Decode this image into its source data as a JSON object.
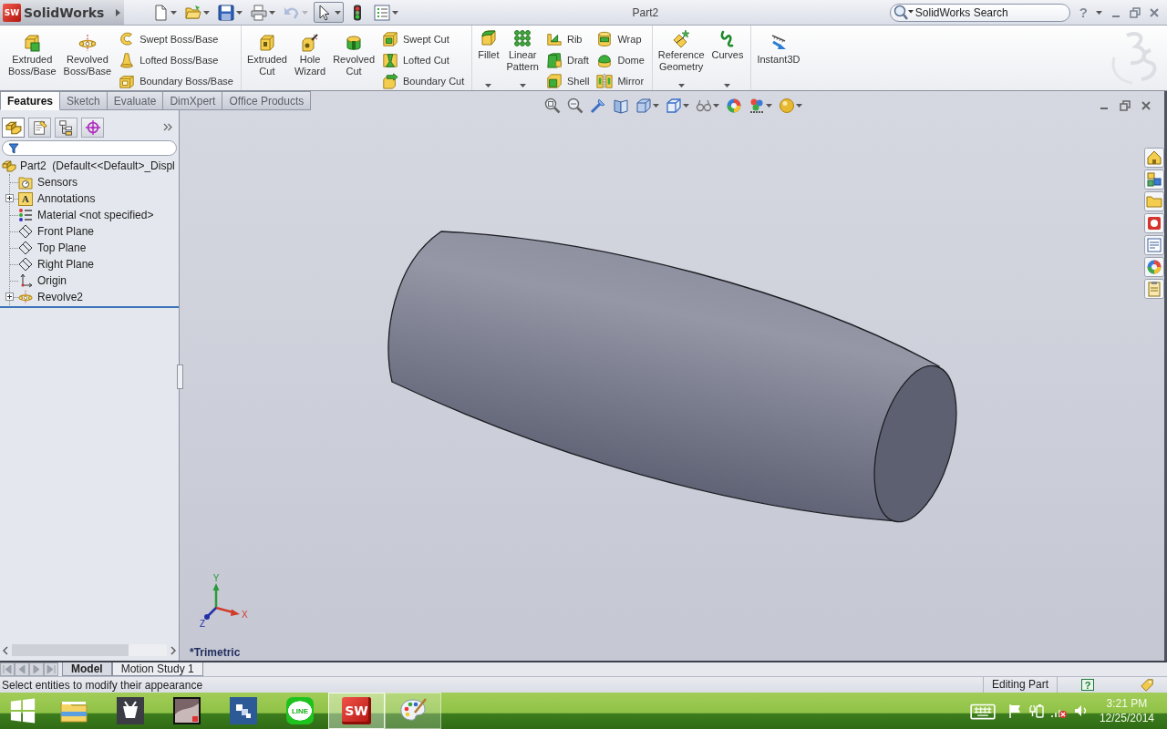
{
  "app": {
    "logo_mark": "SW",
    "name": "SolidWorks",
    "title": "Part2",
    "search": {
      "placeholder": "SolidWorks Search"
    },
    "help": "?"
  },
  "quick_access": [
    {
      "kind": "new",
      "dropdown": true,
      "disabled": false,
      "selected": false
    },
    {
      "kind": "open",
      "dropdown": true,
      "disabled": false,
      "selected": false
    },
    {
      "kind": "save",
      "dropdown": true,
      "disabled": false,
      "selected": false
    },
    {
      "kind": "print",
      "dropdown": true,
      "disabled": false,
      "selected": false
    },
    {
      "kind": "undo",
      "dropdown": true,
      "disabled": true,
      "selected": false
    },
    {
      "kind": "select",
      "dropdown": true,
      "disabled": false,
      "selected": true
    },
    {
      "kind": "rebuild",
      "dropdown": false,
      "disabled": false,
      "selected": false
    },
    {
      "kind": "options",
      "dropdown": true,
      "disabled": false,
      "selected": false
    }
  ],
  "ribbon": {
    "groups": [
      {
        "buttons": [
          {
            "kind": "extrude-boss",
            "label": "Extruded Boss/Base",
            "dropdown": false
          },
          {
            "kind": "revolve-boss",
            "label": "Revolved Boss/Base",
            "dropdown": false
          }
        ],
        "columns": [
          [
            {
              "kind": "swept-boss",
              "label": "Swept Boss/Base"
            },
            {
              "kind": "lofted-boss",
              "label": "Lofted Boss/Base"
            },
            {
              "kind": "boundary-boss",
              "label": "Boundary Boss/Base"
            }
          ]
        ]
      },
      {
        "buttons": [
          {
            "kind": "extrude-cut",
            "label": "Extruded Cut",
            "dropdown": false
          },
          {
            "kind": "hole-wizard",
            "label": "Hole Wizard",
            "dropdown": false
          },
          {
            "kind": "revolve-cut",
            "label": "Revolved Cut",
            "dropdown": false
          }
        ],
        "columns": [
          [
            {
              "kind": "swept-cut",
              "label": "Swept Cut"
            },
            {
              "kind": "lofted-cut",
              "label": "Lofted Cut"
            },
            {
              "kind": "boundary-cut",
              "label": "Boundary Cut"
            }
          ]
        ]
      },
      {
        "buttons": [
          {
            "kind": "fillet",
            "label": "Fillet",
            "dropdown": true
          },
          {
            "kind": "linear-pattern",
            "label": "Linear Pattern",
            "dropdown": true
          }
        ],
        "columns": [
          [
            {
              "kind": "rib",
              "label": "Rib"
            },
            {
              "kind": "draft",
              "label": "Draft"
            },
            {
              "kind": "shell",
              "label": "Shell"
            }
          ],
          [
            {
              "kind": "wrap",
              "label": "Wrap"
            },
            {
              "kind": "dome",
              "label": "Dome"
            },
            {
              "kind": "mirror",
              "label": "Mirror"
            }
          ]
        ]
      },
      {
        "buttons": [
          {
            "kind": "reference-geometry",
            "label": "Reference Geometry",
            "dropdown": true
          },
          {
            "kind": "curves",
            "label": "Curves",
            "dropdown": true
          }
        ]
      },
      {
        "buttons": [
          {
            "kind": "instant3d",
            "label": "Instant3D",
            "dropdown": false
          }
        ]
      }
    ]
  },
  "command_tabs": [
    {
      "label": "Features",
      "selected": true
    },
    {
      "label": "Sketch",
      "selected": false
    },
    {
      "label": "Evaluate",
      "selected": false
    },
    {
      "label": "DimXpert",
      "selected": false
    },
    {
      "label": "Office Products",
      "selected": false
    }
  ],
  "feature_manager": {
    "tabs": [
      {
        "kind": "feature-tree",
        "selected": true
      },
      {
        "kind": "property-manager",
        "selected": false
      },
      {
        "kind": "configuration-manager",
        "selected": false
      },
      {
        "kind": "dimxpert-manager",
        "selected": false
      }
    ],
    "tree": {
      "kind": "part",
      "label": "Part2  (Default<<Default>_Displ",
      "children": [
        {
          "kind": "sensors",
          "label": "Sensors",
          "expandable": false
        },
        {
          "kind": "annotations",
          "icon_text": "A",
          "label": "Annotations",
          "expandable": true
        },
        {
          "kind": "material",
          "label": "Material <not specified>",
          "expandable": false
        },
        {
          "kind": "plane",
          "label": "Front Plane",
          "expandable": false
        },
        {
          "kind": "plane",
          "label": "Top Plane",
          "expandable": false
        },
        {
          "kind": "plane",
          "label": "Right Plane",
          "expandable": false
        },
        {
          "kind": "origin",
          "label": "Origin",
          "expandable": false
        },
        {
          "kind": "revolve",
          "label": "Revolve2",
          "expandable": true
        }
      ]
    }
  },
  "graphics": {
    "heads_up": [
      {
        "kind": "zoom-to-fit",
        "dropdown": false
      },
      {
        "kind": "zoom-area",
        "dropdown": false
      },
      {
        "kind": "previous-view",
        "dropdown": false
      },
      {
        "kind": "section-view",
        "dropdown": false
      },
      {
        "kind": "view-orientation",
        "dropdown": true
      },
      {
        "kind": "display-style",
        "dropdown": true
      },
      {
        "kind": "hide-show",
        "dropdown": true
      },
      {
        "kind": "edit-appearance",
        "dropdown": false
      },
      {
        "kind": "apply-scene",
        "dropdown": true
      },
      {
        "kind": "view-settings",
        "dropdown": true
      }
    ],
    "triad": {
      "x": "X",
      "y": "Y",
      "z": "Z"
    },
    "view_label": "*Trimetric",
    "task_pane": [
      {
        "kind": "home"
      },
      {
        "kind": "design-library"
      },
      {
        "kind": "file-explorer"
      },
      {
        "kind": "view-palette"
      },
      {
        "kind": "properties"
      },
      {
        "kind": "appearances"
      },
      {
        "kind": "custom-properties"
      }
    ]
  },
  "bottom_tabs": [
    {
      "label": "Model",
      "selected": true
    },
    {
      "label": "Motion Study 1",
      "selected": false
    }
  ],
  "status_bar": {
    "message": "Select entities to modify their appearance",
    "mode": "Editing Part",
    "help": "?"
  },
  "taskbar": {
    "apps": [
      {
        "kind": "start",
        "selected": false,
        "running": false
      },
      {
        "kind": "explorer",
        "selected": false,
        "running": false
      },
      {
        "kind": "dark-app",
        "selected": false,
        "running": false
      },
      {
        "kind": "photo-app",
        "selected": false,
        "running": false
      },
      {
        "kind": "squares-app",
        "selected": false,
        "running": false
      },
      {
        "kind": "line",
        "text": "LINE",
        "selected": false,
        "running": false
      },
      {
        "kind": "solidworks",
        "text": "SW",
        "selected": true,
        "running": true
      },
      {
        "kind": "paint",
        "selected": false,
        "running": true
      }
    ],
    "tray": [
      {
        "kind": "keyboard"
      },
      {
        "kind": "flag"
      },
      {
        "kind": "power"
      },
      {
        "kind": "network-off"
      },
      {
        "kind": "volume"
      }
    ],
    "time": "3:21 PM",
    "date": "12/25/2014"
  }
}
